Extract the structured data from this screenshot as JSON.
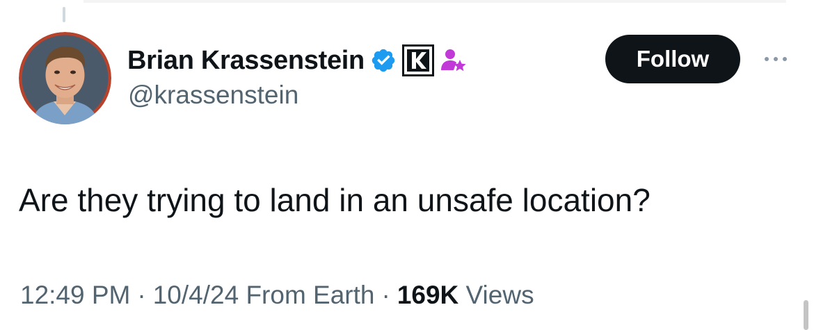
{
  "author": {
    "display_name": "Brian Krassenstein",
    "handle": "@krassenstein",
    "verified_color": "#1d9bf0",
    "affiliate_badge_letter": "K",
    "subscriber_badge_color": "#c13ad8"
  },
  "actions": {
    "follow_label": "Follow"
  },
  "tweet": {
    "text": "Are they trying to land in an unsafe location?",
    "time": "12:49 PM",
    "date": "10/4/24",
    "source": "From Earth",
    "separator": "·",
    "views_count": "169K",
    "views_label": "Views"
  },
  "icons": {
    "verified": "verified-badge-icon",
    "affiliate": "affiliate-k-icon",
    "subscriber": "person-star-icon",
    "more": "more-horizontal-icon"
  }
}
